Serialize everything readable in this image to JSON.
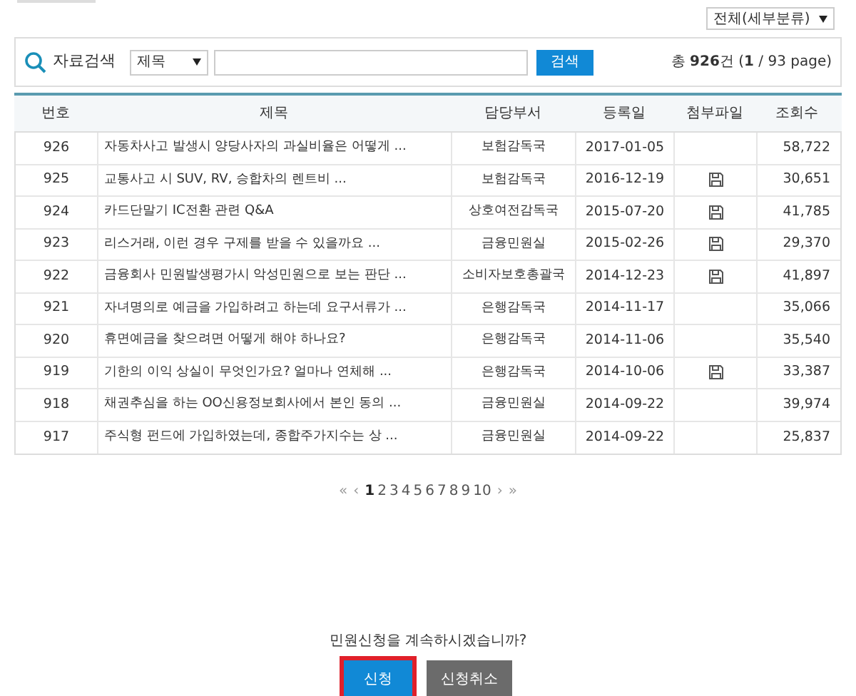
{
  "category_select": {
    "value": "전체(세부분류)"
  },
  "search": {
    "label": "자료검색",
    "field_select": "제목",
    "button": "검색",
    "total_prefix": "총 ",
    "total_count": "926",
    "total_suffix": "건 (",
    "current_page": "1",
    "page_suffix": " / 93 page)"
  },
  "table": {
    "columns": [
      "번호",
      "제목",
      "담당부서",
      "등록일",
      "첨부파일",
      "조회수"
    ],
    "rows": [
      {
        "number": "926",
        "title": "자동차사고 발생시 양당사자의 과실비율은 어떻게 ...",
        "department": "보험감독국",
        "date": "2017-01-05",
        "attachment": false,
        "views": "58,722"
      },
      {
        "number": "925",
        "title": "교통사고 시 SUV, RV, 승합차의 렌트비 ...",
        "department": "보험감독국",
        "date": "2016-12-19",
        "attachment": true,
        "views": "30,651"
      },
      {
        "number": "924",
        "title": "카드단말기 IC전환 관련 Q&A",
        "department": "상호여전감독국",
        "date": "2015-07-20",
        "attachment": true,
        "views": "41,785"
      },
      {
        "number": "923",
        "title": "리스거래, 이런 경우 구제를 받을 수 있을까요 ...",
        "department": "금융민원실",
        "date": "2015-02-26",
        "attachment": true,
        "views": "29,370"
      },
      {
        "number": "922",
        "title": "금융회사 민원발생평가시 악성민원으로 보는 판단 ...",
        "department": "소비자보호총괄국",
        "date": "2014-12-23",
        "attachment": true,
        "views": "41,897"
      },
      {
        "number": "921",
        "title": "자녀명의로 예금을 가입하려고 하는데 요구서류가 ...",
        "department": "은행감독국",
        "date": "2014-11-17",
        "attachment": false,
        "views": "35,066"
      },
      {
        "number": "920",
        "title": "휴면예금을 찾으려면 어떻게 해야 하나요?",
        "department": "은행감독국",
        "date": "2014-11-06",
        "attachment": false,
        "views": "35,540"
      },
      {
        "number": "919",
        "title": "기한의 이익 상실이 무엇인가요? 얼마나 연체해 ...",
        "department": "은행감독국",
        "date": "2014-10-06",
        "attachment": true,
        "views": "33,387"
      },
      {
        "number": "918",
        "title": "채권추심을 하는 OO신용정보회사에서 본인 동의 ...",
        "department": "금융민원실",
        "date": "2014-09-22",
        "attachment": false,
        "views": "39,974"
      },
      {
        "number": "917",
        "title": "주식형 펀드에 가입하였는데, 종합주가지수는 상 ...",
        "department": "금융민원실",
        "date": "2014-09-22",
        "attachment": false,
        "views": "25,837"
      }
    ]
  },
  "pagination": {
    "first": "«",
    "prev": "‹",
    "pages": [
      {
        "label": "1",
        "selected": true
      },
      {
        "label": "2",
        "selected": false
      },
      {
        "label": "3",
        "selected": false
      },
      {
        "label": "4",
        "selected": false
      },
      {
        "label": "5",
        "selected": false
      },
      {
        "label": "6",
        "selected": false
      },
      {
        "label": "7",
        "selected": false
      },
      {
        "label": "8",
        "selected": false
      },
      {
        "label": "9",
        "selected": false
      },
      {
        "label": "10",
        "selected": false
      }
    ],
    "next": "›",
    "last": "»"
  },
  "confirm": {
    "question": "민원신청을 계속하시겠습니까?",
    "buttons": [
      {
        "label": "신청",
        "kind": "primary",
        "focused": true
      },
      {
        "label": "신청취소",
        "kind": "secondary",
        "focused": false
      }
    ]
  }
}
